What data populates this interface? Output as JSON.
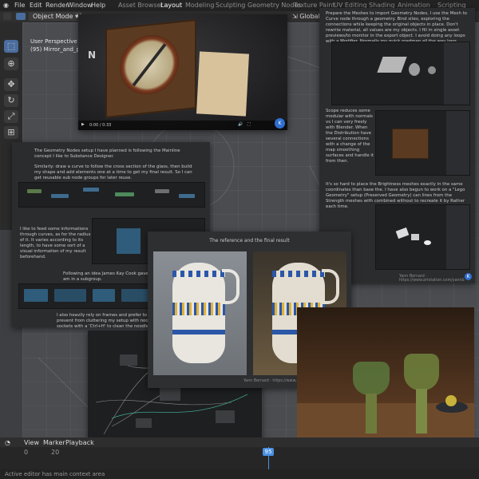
{
  "menubar": {
    "items": [
      "File",
      "Edit",
      "Render",
      "Window",
      "Help"
    ],
    "workspaces": [
      "Asset Browser",
      "Layout",
      "Modeling",
      "Sculpting",
      "Geometry Nodes",
      "Texture Paint",
      "UV Editing",
      "Shading",
      "Animation",
      "Scripting"
    ],
    "active_workspace": "Layout"
  },
  "header": {
    "mode": "Object Mode",
    "view_label": "V",
    "global": "Global"
  },
  "viewport": {
    "perspective": "User Perspective",
    "object": "(95) Mirror_and_paint"
  },
  "video_panel": {
    "time": "0:00 / 0:33"
  },
  "right_panel": {
    "para1": "Prepare the Meshes to import Geometry Nodes, I use the Mesh to Curve node through a geometry. Bind sites, exploring the connections while keeping the original objects in place. Don't rewrite material, all values are my objects. I fill in single asset previews/to monitor in the export object. I avoid doing any loops with a Modifier. Normally my quick roadmap all the way long.",
    "para2": "Scope reduces some modular with normals vs I can very freely with Blender. When the Distribution have several connections with a change of the map smoothing surfaces and handle it from then.",
    "para3": "It's so hard to place the Brightness meshes exactly in the same coordinates than base the. I have also begun to work on a \"Lego Geometry\" setup (Preserved Geometry) can lines from the Strength meshes with combined without to recreate it by Rather each time.",
    "credit": "Yann Bernard · https://www.artstation.com/yannb"
  },
  "left_panel": {
    "intro": "The Geometry Nodes setup I have planned is following the Mainline concept I like to Substance Designer.",
    "intro2": "Similarly: draw a curve to follow the cross section of the glass, then build my shape and add elements one at a time to get my final result. So I can get reusable sub node groups for later reuse.",
    "para2": "I like to feed some informations through curves, as for the radius of it. It varies according to its length, to have some sort of a visual information of my result beforehand.",
    "para3": "Following an idea James Kay Cook gave me, I check where I am in a subgroup.",
    "para4": "I also heavily rely on frames and prefer to use a lot of 'Reroute' to prevent from cluttering my setup with noodles. I then hide unused sockets with a 'Ctrl+H' to clean the noodles.",
    "credit": "Yann Bernard · https://www.artstation.com/yannb"
  },
  "center_panel": {
    "title": "The reference and the final result",
    "credit": "Yann Bernard · https://www.artstation.com/yannb"
  },
  "timeline": {
    "items": [
      "View",
      "Marker",
      "Playback"
    ],
    "frame_start": "0",
    "frame_a": "20",
    "current_frame": "95"
  },
  "statusbar": {
    "text": "Active editor has main context area"
  }
}
